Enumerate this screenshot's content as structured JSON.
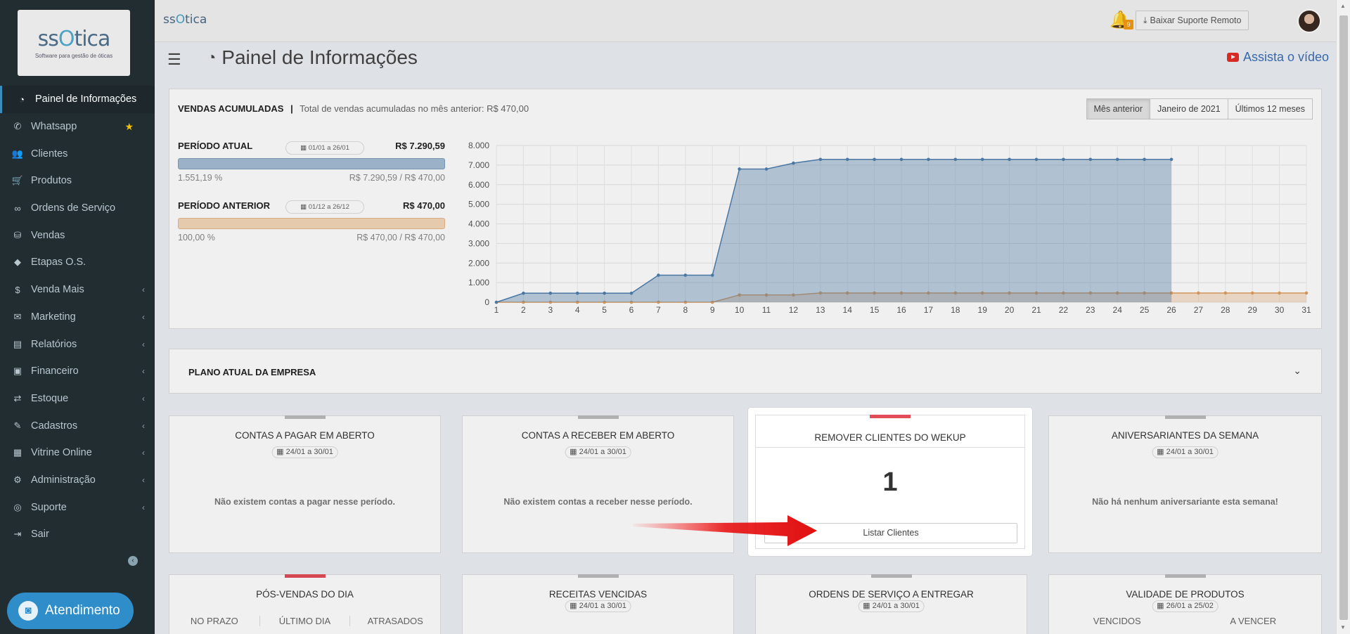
{
  "brand": {
    "logo_text_1": "ss",
    "logo_text_o": "O",
    "logo_text_2": "tica",
    "tagline": "Software para gestão de óticas"
  },
  "sidebar": {
    "items": [
      {
        "label": "Painel de Informações",
        "icon": "dashboard-icon",
        "glyph": "◔",
        "active": true
      },
      {
        "label": "Whatsapp",
        "icon": "whatsapp-icon",
        "glyph": "✆",
        "star": true
      },
      {
        "label": "Clientes",
        "icon": "users-icon",
        "glyph": "👥"
      },
      {
        "label": "Produtos",
        "icon": "cart-icon",
        "glyph": "🛒"
      },
      {
        "label": "Ordens de Serviço",
        "icon": "glasses-icon",
        "glyph": "∞"
      },
      {
        "label": "Vendas",
        "icon": "basket-icon",
        "glyph": "⛁"
      },
      {
        "label": "Etapas O.S.",
        "icon": "tag-icon",
        "glyph": "◆"
      },
      {
        "label": "Venda Mais",
        "icon": "dollar-icon",
        "glyph": "$",
        "chevron": true
      },
      {
        "label": "Marketing",
        "icon": "comments-icon",
        "glyph": "✉",
        "chevron": true
      },
      {
        "label": "Relatórios",
        "icon": "reports-icon",
        "glyph": "▤",
        "chevron": true
      },
      {
        "label": "Financeiro",
        "icon": "money-icon",
        "glyph": "▣",
        "chevron": true
      },
      {
        "label": "Estoque",
        "icon": "exchange-icon",
        "glyph": "⇄",
        "chevron": true
      },
      {
        "label": "Cadastros",
        "icon": "edit-icon",
        "glyph": "✎",
        "chevron": true
      },
      {
        "label": "Vitrine Online",
        "icon": "shop-icon",
        "glyph": "▦",
        "chevron": true
      },
      {
        "label": "Administração",
        "icon": "cogs-icon",
        "glyph": "⚙",
        "chevron": true
      },
      {
        "label": "Suporte",
        "icon": "globe-icon",
        "glyph": "◎",
        "chevron": true
      },
      {
        "label": "Sair",
        "icon": "sign-out-icon",
        "glyph": "⇥"
      }
    ],
    "atendimento_label": "Atendimento"
  },
  "topbar": {
    "suporte_label": "Baixar Suporte Remoto",
    "notifications_count": "9"
  },
  "header": {
    "title": "Painel de Informações",
    "video_label": "Assista o vídeo"
  },
  "sales": {
    "title": "VENDAS ACUMULADAS",
    "subtitle": "Total de vendas acumuladas no mês anterior:",
    "subtitle_value": "R$ 470,00",
    "buttons": [
      "Mês anterior",
      "Janeiro de 2021",
      "Últimos 12 meses"
    ],
    "current": {
      "label": "PERÍODO ATUAL",
      "dates": "01/01 a 26/01",
      "total": "R$ 7.290,59",
      "pct": "1.551,19 %",
      "range": "R$ 7.290,59 / R$ 470,00",
      "fill": 1.0
    },
    "previous": {
      "label": "PERÍODO ANTERIOR",
      "dates": "01/12 a 26/12",
      "total": "R$ 470,00",
      "pct": "100,00 %",
      "range": "R$ 470,00 / R$ 470,00",
      "fill": 1.0
    }
  },
  "chart_data": {
    "type": "area",
    "x": [
      1,
      2,
      3,
      4,
      5,
      6,
      7,
      8,
      9,
      10,
      11,
      12,
      13,
      14,
      15,
      16,
      17,
      18,
      19,
      20,
      21,
      22,
      23,
      24,
      25,
      26,
      27,
      28,
      29,
      30,
      31
    ],
    "ylim": [
      0,
      8000
    ],
    "yticks": [
      "0",
      "1.000",
      "2.000",
      "3.000",
      "4.000",
      "5.000",
      "6.000",
      "7.000",
      "8.000"
    ],
    "series": [
      {
        "color": "#4f7fae",
        "values": [
          0,
          460,
          460,
          460,
          460,
          460,
          1380,
          1380,
          1380,
          6800,
          6800,
          7100,
          7290.59,
          7290.59,
          7290.59,
          7290.59,
          7290.59,
          7290.59,
          7290.59,
          7290.59,
          7290.59,
          7290.59,
          7290.59,
          7290.59,
          7290.59,
          7290.59
        ]
      },
      {
        "color": "#e0a060",
        "values": [
          0,
          0,
          0,
          0,
          0,
          0,
          0,
          0,
          0,
          370,
          370,
          370,
          470,
          470,
          470,
          470,
          470,
          470,
          470,
          470,
          470,
          470,
          470,
          470,
          470,
          470,
          470,
          470,
          470,
          470,
          470
        ]
      }
    ]
  },
  "plan": {
    "title": "PLANO ATUAL DA EMPRESA"
  },
  "cards": {
    "pagar": {
      "title": "CONTAS A PAGAR EM ABERTO",
      "date": "24/01 a 30/01",
      "msg": "Não existem contas a pagar nesse período."
    },
    "receber": {
      "title": "CONTAS A RECEBER EM ABERTO",
      "date": "24/01 a 30/01",
      "msg": "Não existem contas a receber nesse período."
    },
    "wekup": {
      "title": "REMOVER CLIENTES DO WEKUP",
      "count": "1",
      "button": "Listar Clientes"
    },
    "aniversariantes": {
      "title": "ANIVERSARIANTES DA SEMANA",
      "date": "24/01 a 30/01",
      "msg": "Não há nenhum aniversariante esta semana!"
    },
    "posvendas": {
      "title": "PÓS-VENDAS DO DIA",
      "cols": [
        "NO PRAZO",
        "ÚLTIMO DIA",
        "ATRASADOS"
      ]
    },
    "receitas": {
      "title": "RECEITAS VENCIDAS",
      "date": "24/01 a 30/01"
    },
    "ordens": {
      "title": "ORDENS DE SERVIÇO A ENTREGAR",
      "date": "24/01 a 30/01"
    },
    "validade": {
      "title": "VALIDADE DE PRODUTOS",
      "date": "26/01 a 25/02",
      "cols": [
        "VENCIDOS",
        "A VENCER"
      ]
    }
  },
  "colors": {
    "sidebar": "#222d32",
    "accent": "#3c8dbc",
    "danger": "#e34d59",
    "series_current": "#4f7fae",
    "series_previous": "#e0a060"
  }
}
